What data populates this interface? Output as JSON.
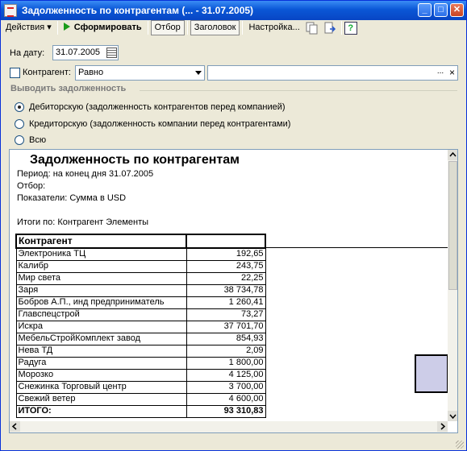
{
  "window": {
    "title": "Задолженность по контрагентам (... - 31.07.2005)",
    "buttons": {
      "minimize": "_",
      "maximize": "□",
      "close": "✕"
    }
  },
  "toolbar": {
    "actions": "Действия",
    "generate": "Сформировать",
    "filter": "Отбор",
    "header": "Заголовок",
    "settings": "Настройка...",
    "help": "?"
  },
  "form": {
    "date_label": "На дату:",
    "date_value": "31.07.2005",
    "contractor_label": "Контрагент:",
    "contractor_condition": "Равно",
    "contractor_value": "",
    "ellipsis": "...",
    "clear": "×",
    "group_title": "Выводить задолженность",
    "options": [
      {
        "label": "Дебиторскую (задолженность контрагентов перед компанией)",
        "selected": true
      },
      {
        "label": "Кредиторскую (задолженность компании перед контрагентами)",
        "selected": false
      },
      {
        "label": "Всю",
        "selected": false
      }
    ]
  },
  "report": {
    "title": "Задолженность по контрагентам",
    "period": "Период: на конец дня 31.07.2005",
    "filter": "Отбор:",
    "indicators": "Показатели: Сумма в USD",
    "totals_by": "Итоги по:  Контрагент Элементы",
    "column_header": "Контрагент",
    "rows": [
      {
        "name": "Электроника ТЦ",
        "value": "192,65"
      },
      {
        "name": "Калибр",
        "value": "243,75"
      },
      {
        "name": "Мир света",
        "value": "22,25"
      },
      {
        "name": "Заря",
        "value": "38 734,78"
      },
      {
        "name": "Бобров А.П., инд предприниматель",
        "value": "1 260,41"
      },
      {
        "name": "Главспецстрой",
        "value": "73,27"
      },
      {
        "name": "Искра",
        "value": "37 701,70"
      },
      {
        "name": "МебельСтройКомплект завод",
        "value": "854,93"
      },
      {
        "name": "Нева ТД",
        "value": "2,09"
      },
      {
        "name": "Радуга",
        "value": "1 800,00"
      },
      {
        "name": "Морозко",
        "value": "4 125,00"
      },
      {
        "name": "Снежинка Торговый центр",
        "value": "3 700,00"
      },
      {
        "name": "Свежий ветер",
        "value": "4 600,00"
      }
    ],
    "total": {
      "name": "ИТОГО:",
      "value": "93 310,83"
    }
  }
}
